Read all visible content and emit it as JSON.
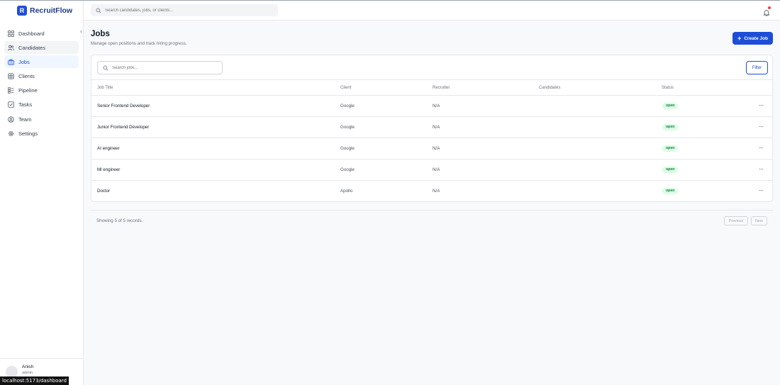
{
  "app": {
    "name": "RecruitFlow",
    "logo_letter": "R"
  },
  "sidebar": {
    "items": [
      {
        "label": "Dashboard",
        "icon": "grid-icon"
      },
      {
        "label": "Candidates",
        "icon": "users-icon"
      },
      {
        "label": "Jobs",
        "icon": "briefcase-icon",
        "active": true
      },
      {
        "label": "Clients",
        "icon": "building-icon"
      },
      {
        "label": "Pipeline",
        "icon": "kanban-icon"
      },
      {
        "label": "Tasks",
        "icon": "check-square-icon"
      },
      {
        "label": "Team",
        "icon": "user-circle-icon"
      },
      {
        "label": "Settings",
        "icon": "gear-icon"
      }
    ],
    "user": {
      "name": "Anish",
      "role": "admin"
    },
    "status_url": "localhost:5173/dashboard"
  },
  "topbar": {
    "search_placeholder": "Search candidates, jobs, or clients..."
  },
  "page": {
    "title": "Jobs",
    "subtitle": "Manage open positions and track hiring progress.",
    "create_label": "Create Job"
  },
  "table": {
    "search_placeholder": "Search jobs...",
    "filter_label": "Filter",
    "columns": [
      "Job Title",
      "Client",
      "Recruiter",
      "Candidates",
      "Status"
    ],
    "rows": [
      {
        "title": "Senior Frontend Developer",
        "client": "Google",
        "recruiter": "N/A",
        "candidates": "",
        "status": "open"
      },
      {
        "title": "Junior Frontend Developer",
        "client": "Google",
        "recruiter": "N/A",
        "candidates": "",
        "status": "open"
      },
      {
        "title": "AI engineer",
        "client": "Google",
        "recruiter": "N/A",
        "candidates": "",
        "status": "open"
      },
      {
        "title": "Ml engineer",
        "client": "Google",
        "recruiter": "N/A",
        "candidates": "",
        "status": "open"
      },
      {
        "title": "Doctor",
        "client": "Apollo",
        "recruiter": "N/A",
        "candidates": "",
        "status": "open"
      }
    ],
    "more_glyph": "···"
  },
  "footer": {
    "records_text": "Showing 5 of 5 records.",
    "prev_label": "Previous",
    "next_label": "Next"
  },
  "colors": {
    "accent": "#1d4ed8",
    "status_open_bg": "#dcfce7",
    "status_open_text": "#15803d"
  }
}
